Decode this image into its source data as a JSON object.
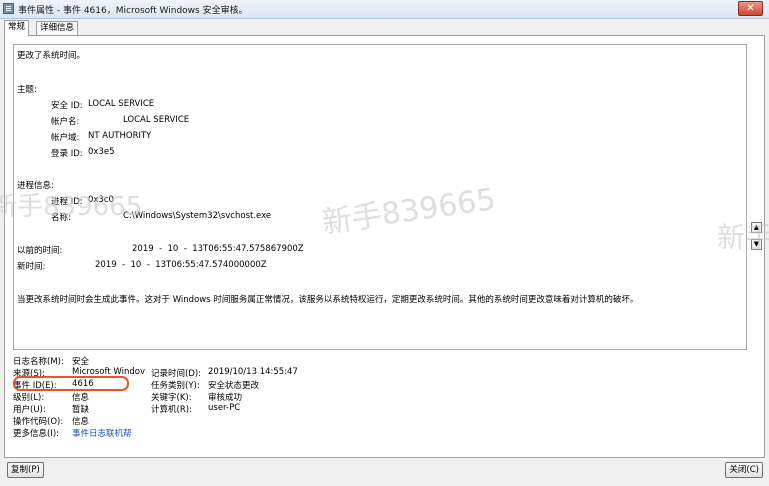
{
  "window": {
    "title": "事件属性 - 事件 4616，Microsoft Windows 安全审核。",
    "close_glyph": "✕"
  },
  "tabs": [
    {
      "label": "常规"
    },
    {
      "label": "详细信息"
    }
  ],
  "description": {
    "summary": "更改了系统时间。",
    "subject_header": "主题:",
    "subject": [
      {
        "label": "安全 ID:",
        "value": "LOCAL SERVICE"
      },
      {
        "label": "帐户名:",
        "value": "LOCAL SERVICE"
      },
      {
        "label": "帐户域:",
        "value": "NT AUTHORITY"
      },
      {
        "label": "登录 ID:",
        "value": "0x3e5"
      }
    ],
    "process_header": "进程信息:",
    "process": [
      {
        "label": "进程 ID:",
        "value": "0x3c0"
      },
      {
        "label": "名称:",
        "value": "C:\\Windows\\System32\\svchost.exe"
      }
    ],
    "previous_time_label": "以前的时间:",
    "previous_time_value": "2019  -  10  -  13T06:55:47.575867900Z",
    "new_time_label": "新时间:",
    "new_time_value": "2019  -  10  -  13T06:55:47.574000000Z",
    "note": "当更改系统时间时会生成此事件。这对于 Windows 时间服务属正常情况，该服务以系统特权运行，定期更改系统时间。其他的系统时间更改意味着对计算机的破坏。"
  },
  "watermarks": [
    "新手839665",
    "新手839665",
    "新手"
  ],
  "properties": {
    "log_name_label": "日志名称(M):",
    "log_name": "安全",
    "source_label": "来源(S):",
    "source": "Microsoft Windov",
    "logged_label": "记录时间(D):",
    "logged": "2019/10/13 14:55:47",
    "event_id_label": "事件 ID(E):",
    "event_id": "4616",
    "task_label": "任务类别(Y):",
    "task": "安全状态更改",
    "level_label": "级别(L):",
    "level": "信息",
    "keywords_label": "关键字(K):",
    "keywords": "审核成功",
    "user_label": "用户(U):",
    "user": "暂缺",
    "computer_label": "计算机(R):",
    "computer": "user-PC",
    "opcode_label": "操作代码(O):",
    "opcode": "信息",
    "more_info_label": "更多信息(I):",
    "more_info_link": "事件日志联机帮"
  },
  "buttons": {
    "copy": "复制(P)",
    "close": "关闭(C)"
  },
  "colors": {
    "highlight": "#e8532a",
    "link": "#1f4fb3"
  }
}
